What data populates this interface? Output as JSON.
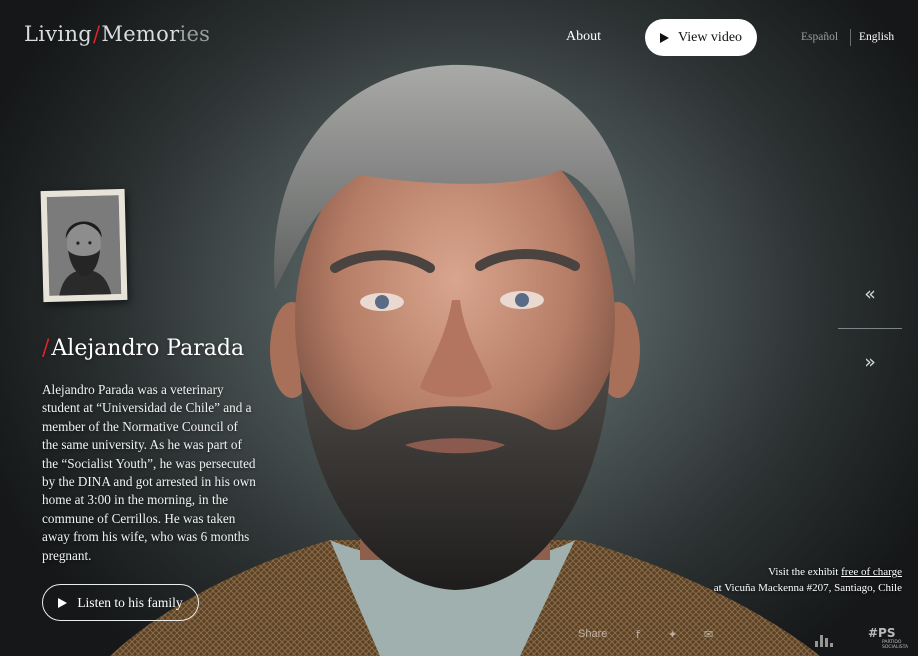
{
  "header": {
    "logo": {
      "part1": "Living",
      "slash": "/",
      "part2": "Memor",
      "part3": "ies"
    },
    "nav_about": "About",
    "view_video": "View video",
    "lang_es": "Español",
    "lang_en": "English"
  },
  "person": {
    "name_slash": "/",
    "name": "Alejandro Parada",
    "bio": "Alejandro Parada was a veterinary student at “Universidad de Chile” and a member of the Normative Council of the same university. As he was part of the “Socialist Youth”, he was persecuted by the DINA and got arrested in his own home at 3:00 in the morning, in the commune of Cerrillos. He was taken away from his wife, who was 6 months pregnant.",
    "listen_button": "Listen to his family"
  },
  "navigation": {
    "prev": "«",
    "next": "»"
  },
  "visit": {
    "line1_prefix": "Visit the exhibit ",
    "line1_link": "free of charge",
    "line2": "at Vicuña Mackenna #207, Santiago, Chile"
  },
  "footer": {
    "share": "Share",
    "facebook_glyph": "f",
    "twitter_glyph": "✦",
    "mail_glyph": "✉",
    "ps_mark": "#PS",
    "ps_sub_1": "PARTIDO",
    "ps_sub_2": "SOCIALISTA"
  },
  "icons": [
    "play-icon",
    "chevron-double-left-icon",
    "chevron-double-right-icon",
    "facebook-icon",
    "twitter-icon",
    "mail-icon",
    "stats-icon"
  ],
  "colors": {
    "accent_red": "#d9262a",
    "button_bg": "#ffffff",
    "text": "#ffffff"
  }
}
